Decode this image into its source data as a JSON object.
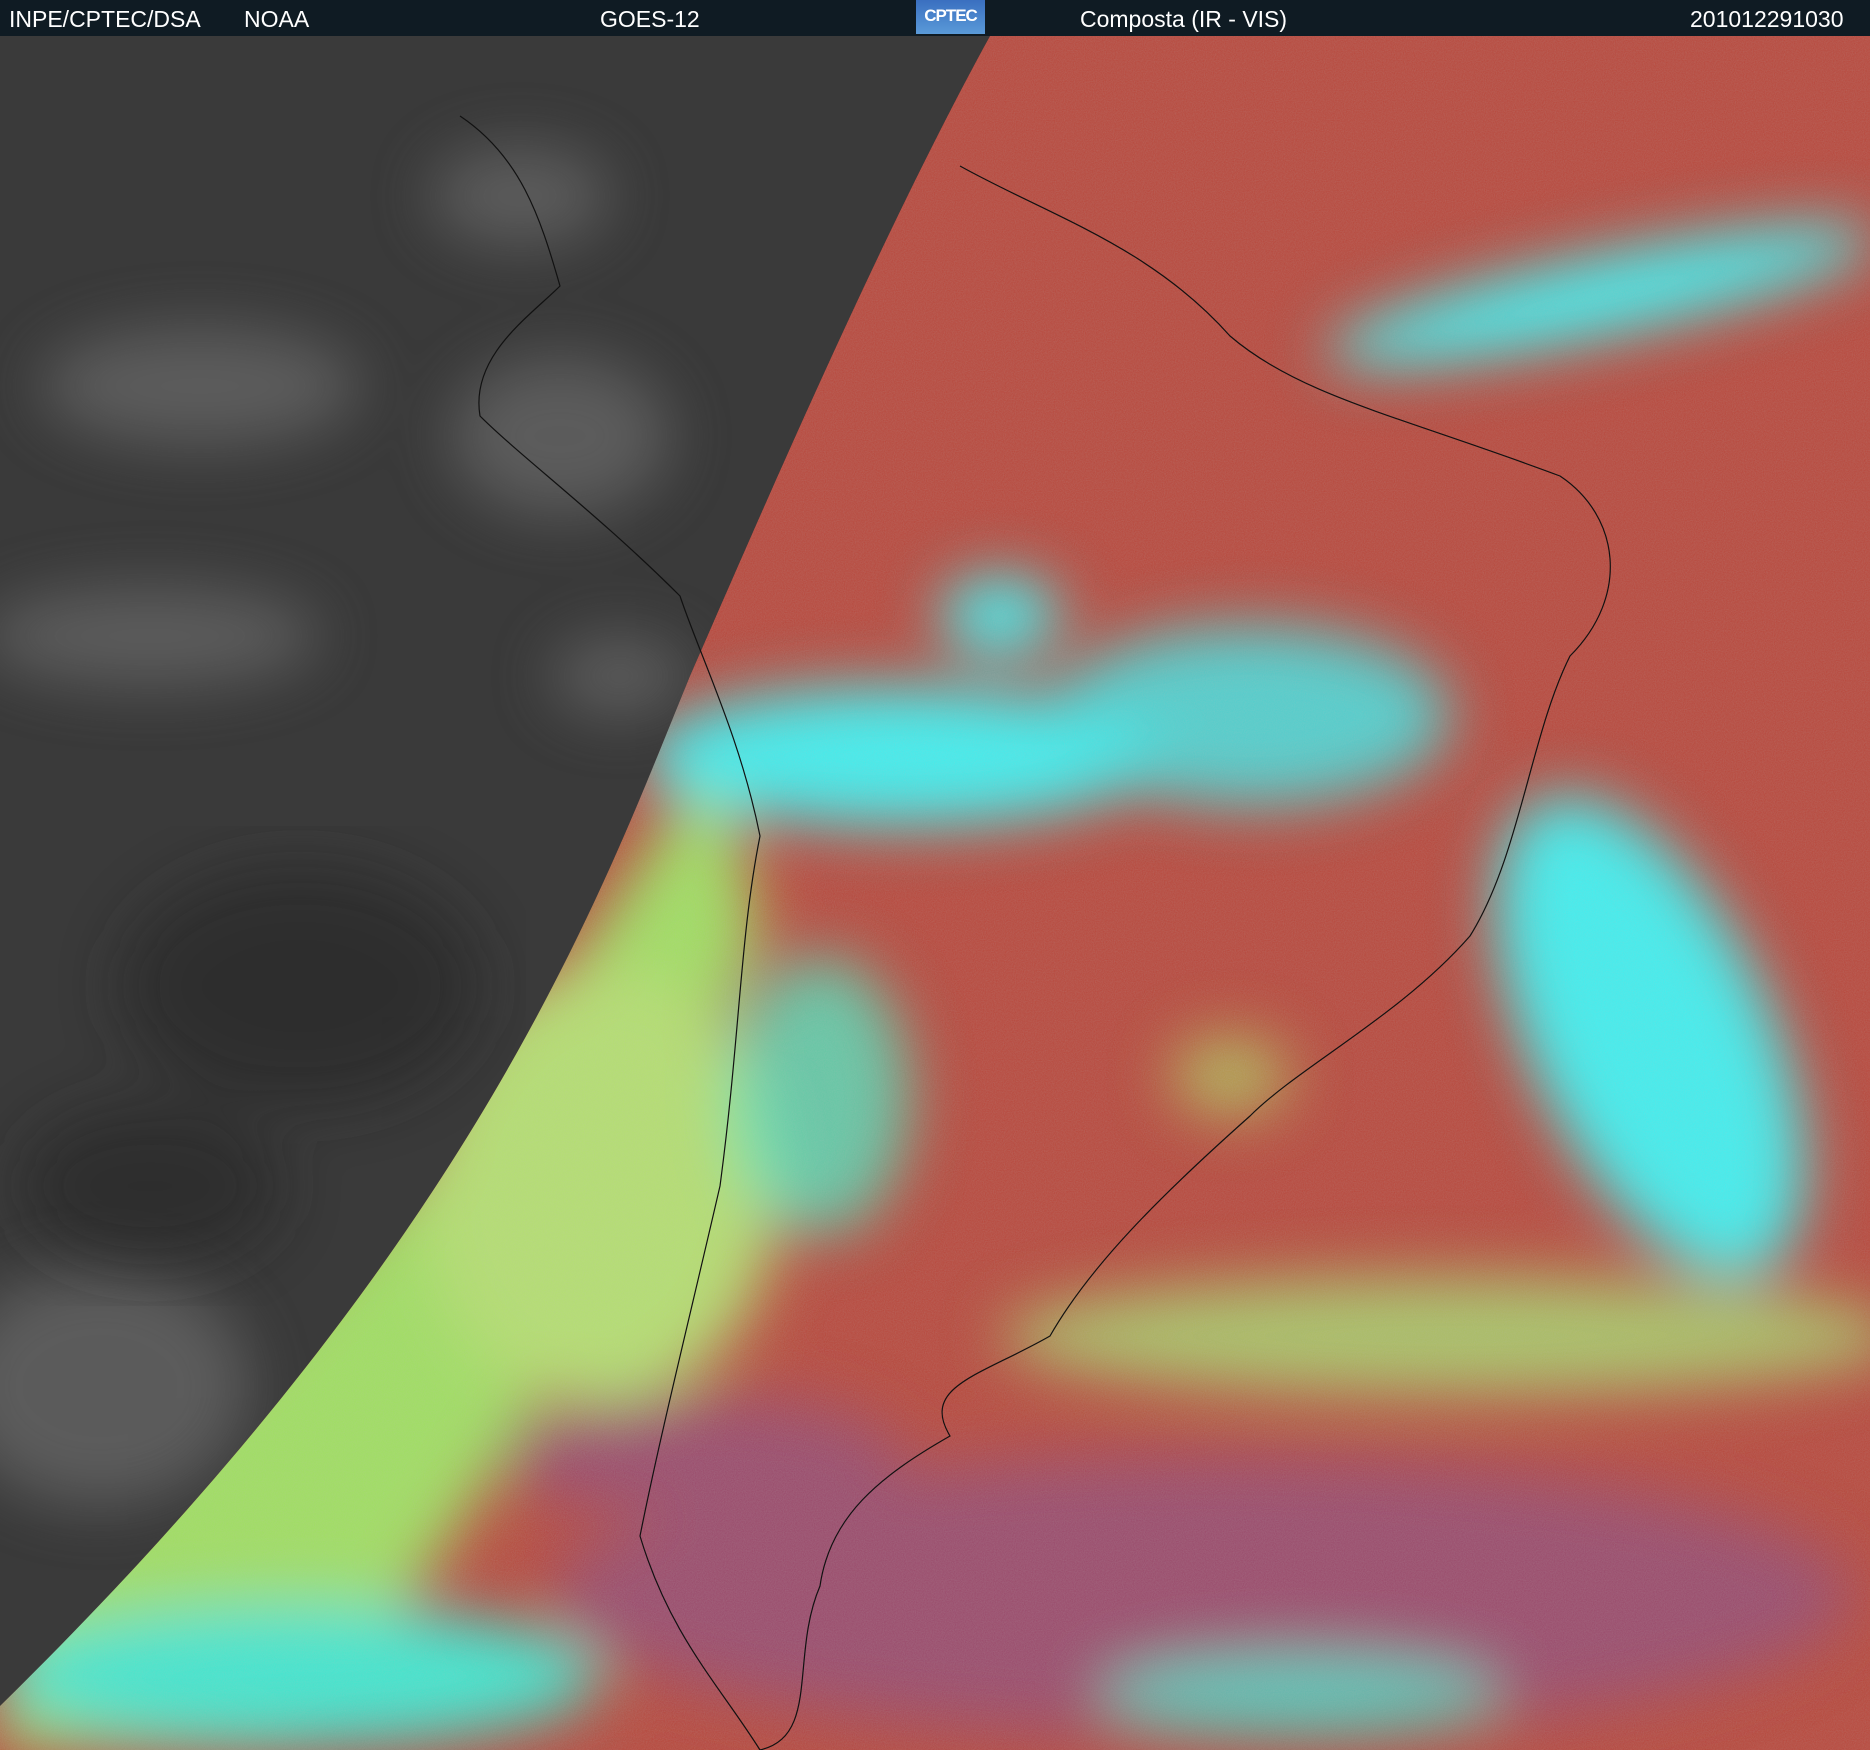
{
  "header": {
    "org": "INPE/CPTEC/DSA",
    "agency": "NOAA",
    "satellite": "GOES-12",
    "logo_text": "CPTEC",
    "product": "Composta (IR - VIS)",
    "timestamp": "201012291030"
  },
  "colors": {
    "header_bg": "#0f1b23",
    "night_side": "#3a3a3a",
    "land_red": "#b8463a",
    "cloud_cyan": "#3ff0f0",
    "low_cloud_green": "#a0e060",
    "ocean_magenta": "#9a4a6a"
  }
}
